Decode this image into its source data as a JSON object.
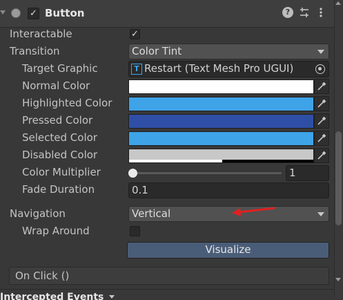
{
  "header": {
    "title": "Button",
    "enabled": true,
    "icons": [
      "help-icon",
      "preset-icon",
      "more-icon"
    ]
  },
  "properties": {
    "interactable": {
      "label": "Interactable",
      "checked": true
    },
    "transition": {
      "label": "Transition",
      "value": "Color Tint"
    },
    "target_graphic": {
      "label": "Target Graphic",
      "value": "Restart (Text Mesh Pro UGUI)"
    },
    "normal_color": {
      "label": "Normal Color",
      "color": "#ffffff"
    },
    "highlighted_color": {
      "label": "Highlighted Color",
      "color": "#3fa3e8"
    },
    "pressed_color": {
      "label": "Pressed Color",
      "color": "#2f4fa6"
    },
    "selected_color": {
      "label": "Selected Color",
      "color": "#3fa3e8"
    },
    "disabled_color": {
      "label": "Disabled Color",
      "color": "#c8c8c8"
    },
    "color_multiplier": {
      "label": "Color Multiplier",
      "value": "1",
      "slider_fraction": 0.0
    },
    "fade_duration": {
      "label": "Fade Duration",
      "value": "0.1"
    },
    "navigation": {
      "label": "Navigation",
      "value": "Vertical"
    },
    "wrap_around": {
      "label": "Wrap Around",
      "checked": false
    },
    "visualize_label": "Visualize"
  },
  "events": {
    "on_click": "On Click ()",
    "intercepted": "Intercepted Events"
  },
  "colors": {
    "annotation_arrow": "#e02020",
    "button_accent": "#4a5d78"
  }
}
